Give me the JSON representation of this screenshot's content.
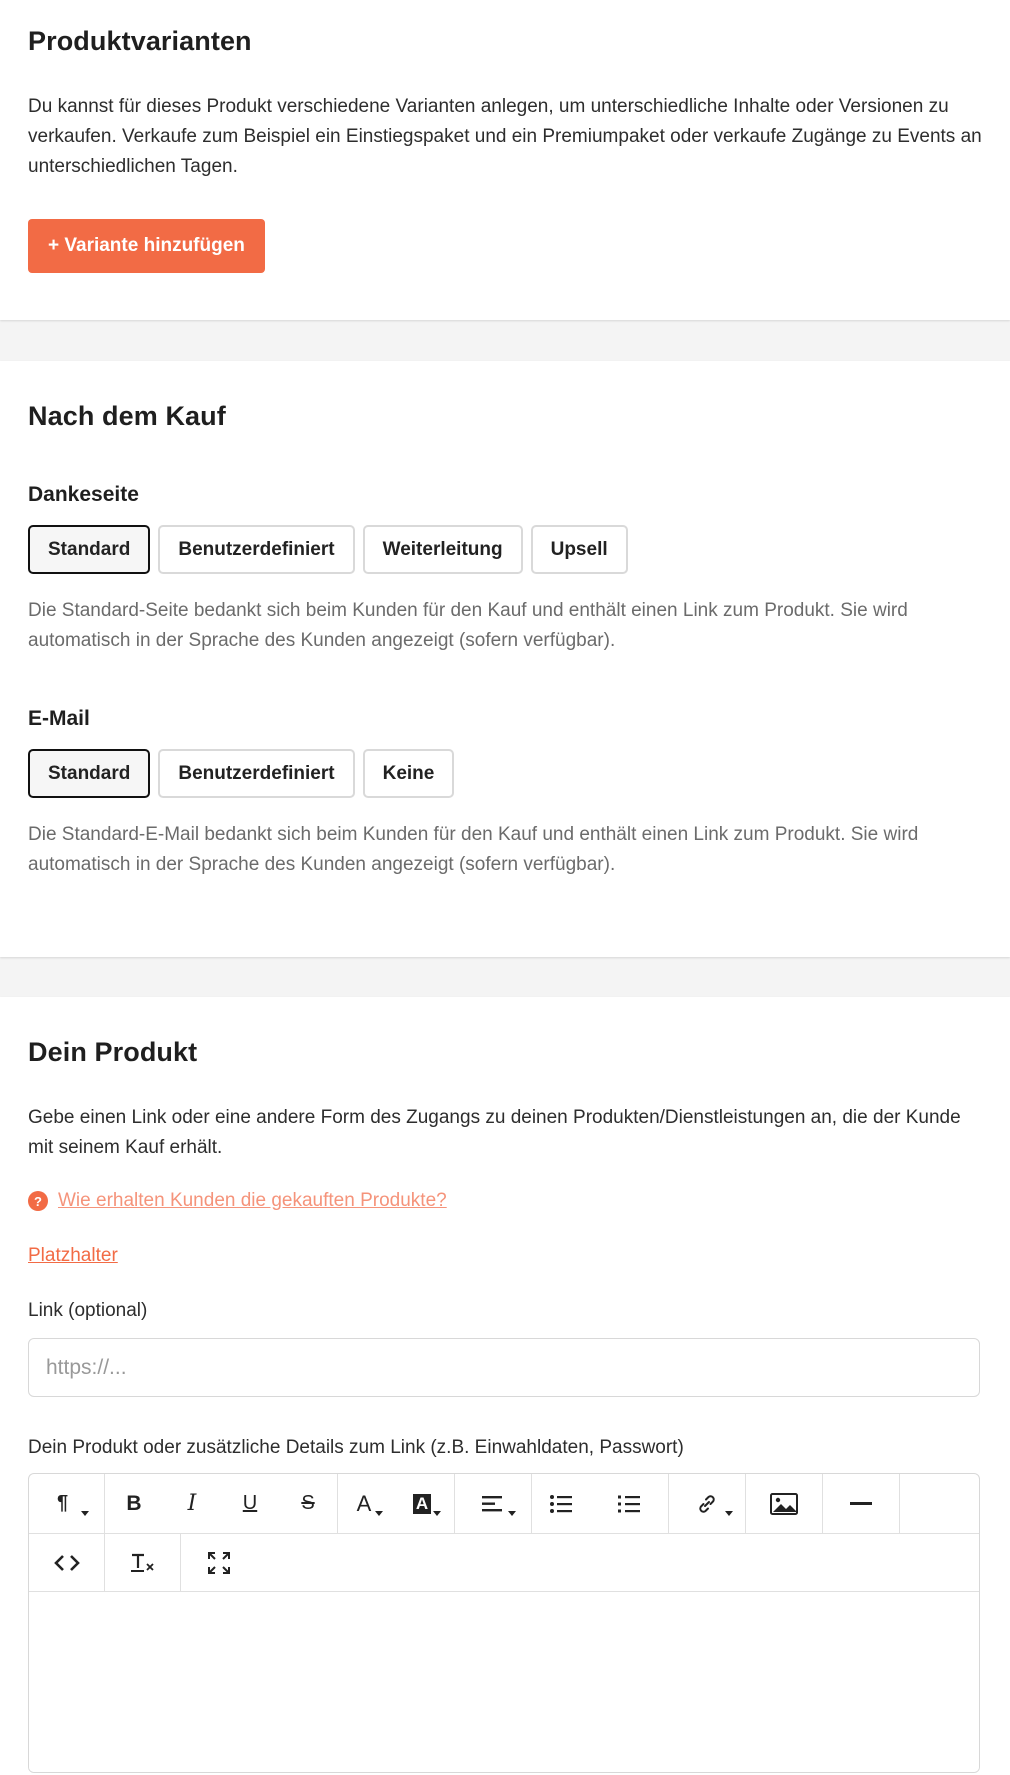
{
  "variants": {
    "title": "Produktvarianten",
    "description": "Du kannst für dieses Produkt verschiedene Varianten anlegen, um unterschiedliche Inhalte oder Versionen zu verkaufen. Verkaufe zum Beispiel ein Einstiegspaket und ein Premiumpaket oder verkaufe Zugänge zu Events an unterschiedlichen Tagen.",
    "add_button": "+ Variante hinzufügen"
  },
  "after_purchase": {
    "title": "Nach dem Kauf",
    "thankyou": {
      "label": "Dankeseite",
      "options": [
        "Standard",
        "Benutzerdefiniert",
        "Weiterleitung",
        "Upsell"
      ],
      "selected": "Standard",
      "description": "Die Standard-Seite bedankt sich beim Kunden für den Kauf und enthält einen Link zum Produkt. Sie wird automatisch in der Sprache des Kunden angezeigt (sofern verfügbar)."
    },
    "email": {
      "label": "E-Mail",
      "options": [
        "Standard",
        "Benutzerdefiniert",
        "Keine"
      ],
      "selected": "Standard",
      "description": "Die Standard-E-Mail bedankt sich beim Kunden für den Kauf und enthält einen Link zum Produkt. Sie wird automatisch in der Sprache des Kunden angezeigt (sofern verfügbar)."
    }
  },
  "product": {
    "title": "Dein Produkt",
    "description": "Gebe einen Link oder eine andere Form des Zugangs zu deinen Produkten/Dienstleistungen an, die der Kunde mit seinem Kauf erhält.",
    "help_link": "Wie erhalten Kunden die gekauften Produkte?",
    "placeholder_link": "Platzhalter",
    "link_label": "Link (optional)",
    "link_placeholder": "https://...",
    "details_label": "Dein Produkt oder zusätzliche Details zum Link (z.B. Einwahldaten, Passwort)"
  },
  "icons": {
    "help": "question-circle-icon",
    "paragraph": "¶",
    "bold": "B",
    "italic": "I",
    "underline": "U",
    "strike": "S",
    "font_color": "A",
    "bg_color": "A"
  },
  "colors": {
    "accent": "#f26b45",
    "help_link": "#f5937a"
  }
}
